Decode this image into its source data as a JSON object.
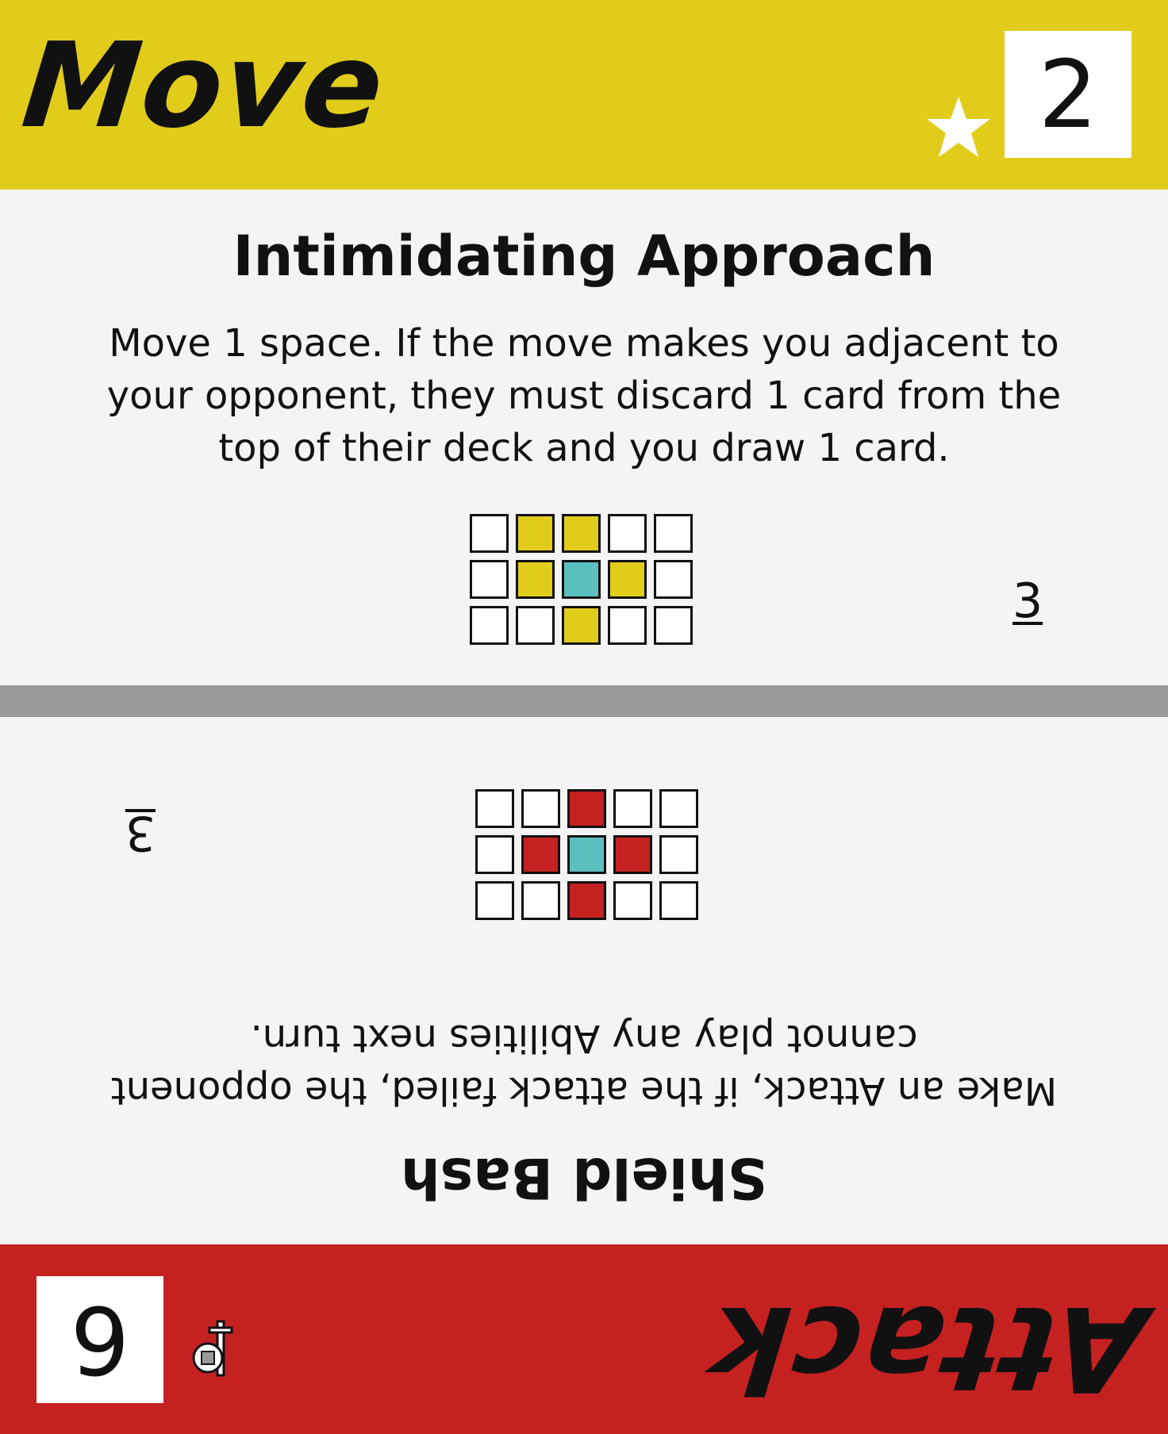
{
  "top": {
    "type_label": "Move",
    "cost": "2",
    "name": "Intimidating Approach",
    "text": "Move 1 space. If the move makes you adjacent to your opponent, they must discard 1 card from the top of their deck and you draw 1 card.",
    "range": "3",
    "icon": "star-icon",
    "band_color": "#e1cc1c",
    "pattern_color": "#e1cc1c",
    "center_color": "#5bbfbf",
    "pattern": [
      [
        "empty",
        "active",
        "active",
        "empty",
        "empty"
      ],
      [
        "empty",
        "active",
        "center",
        "active",
        "empty"
      ],
      [
        "empty",
        "empty",
        "active",
        "empty",
        "empty"
      ]
    ]
  },
  "bottom": {
    "type_label": "Attack",
    "cost": "6",
    "name": "Shield Bash",
    "text": "Make an Attack, if the attack failed, the opponent cannot play any Abilities next turn.",
    "range": "3",
    "icon": "shield-sword-icon",
    "band_color": "#c52121",
    "pattern_color": "#c52121",
    "center_color": "#5bbfbf",
    "pattern": [
      [
        "empty",
        "empty",
        "active",
        "empty",
        "empty"
      ],
      [
        "empty",
        "active",
        "center",
        "active",
        "empty"
      ],
      [
        "empty",
        "empty",
        "active",
        "empty",
        "empty"
      ]
    ]
  },
  "divider_color": "#999999"
}
